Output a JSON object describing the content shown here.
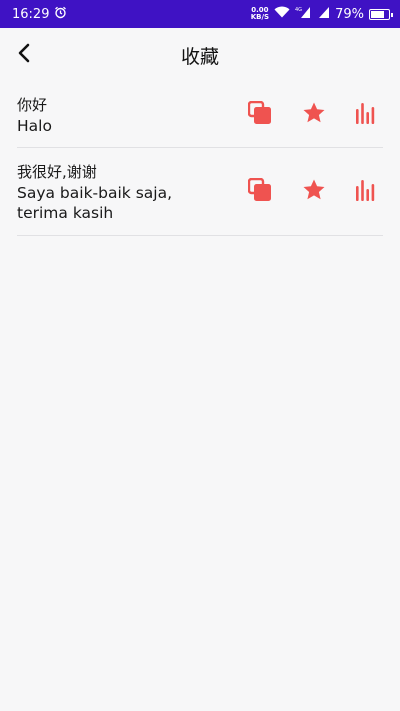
{
  "status_bar": {
    "time": "16:29",
    "net_speed_value": "0.00",
    "net_speed_unit": "KB/S",
    "battery_percent": "79%",
    "battery_level": 0.79,
    "icons": [
      "alarm-icon",
      "wifi-icon",
      "signal-4g-icon",
      "signal-icon",
      "battery-icon"
    ]
  },
  "header": {
    "title": "收藏",
    "back_icon": "chevron-left-icon"
  },
  "favorites": [
    {
      "chinese": "你好",
      "translation": "Halo"
    },
    {
      "chinese": "我很好,谢谢",
      "translation": "Saya baik-baik saja, terima kasih"
    }
  ],
  "actions": {
    "copy_icon": "copy-icon",
    "star_icon": "star-icon",
    "audio_icon": "audio-bars-icon"
  },
  "colors": {
    "status_bar_bg": "#3f12c4",
    "accent": "#ef5350",
    "background": "#f7f7f8",
    "divider": "#e1e1e4"
  }
}
